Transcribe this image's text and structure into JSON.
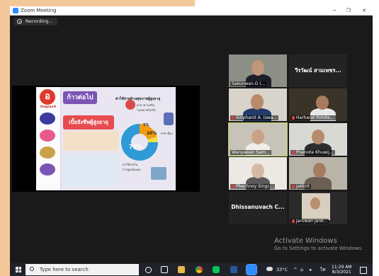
{
  "window": {
    "title": "Zoom Meeting",
    "controls": {
      "minimize": "─",
      "restore": "❐",
      "close": "✕"
    }
  },
  "recording": {
    "label": "Recording..."
  },
  "slide": {
    "title": "ก้าวต่อไป",
    "banner": "เบี้ยยังชีพผู้สูงอายุ",
    "subtitle": "ค่าใช้จ่ายด้านสุขภาพผู้สูงอายุ",
    "brand": "Ongsavit",
    "logo_glyph": "อ",
    "pct_main": "75%",
    "pct_second": "20%",
    "pct_third": "5%",
    "note_left": "ค่าใช้จ่ายในการดูแลตนเอง",
    "note_right": "ค่ายาอื่นๆ",
    "note_top": "ค่าอาหารเสริมโฆษณาเกินจริง"
  },
  "participants": [
    {
      "name": "Sakunwan.O (...",
      "video": true
    },
    {
      "name": "วีรวัฒน์ สามเพชร...",
      "video": false
    },
    {
      "name": "Siriphanit A. (swa...",
      "video": true
    },
    {
      "name": "Harharat Rimite...",
      "video": true
    },
    {
      "name": "Wanyawan Sam...",
      "video": true
    },
    {
      "name": "Pramote Khuwij...",
      "video": true
    },
    {
      "name": "Phechnoy Singc...",
      "video": true
    },
    {
      "name": "Jakkrit",
      "video": true
    },
    {
      "name": "Dhissanuvach C...",
      "video": false
    },
    {
      "name": "Jaruwan Jank...",
      "video": true
    }
  ],
  "activate": {
    "line1": "Activate Windows",
    "line2": "Go to Settings to activate Windows."
  },
  "taskbar": {
    "search_placeholder": "Type here to search",
    "temperature": "33°C",
    "lang": "ไท",
    "time": "11:29 AM",
    "date": "8/3/2021"
  }
}
